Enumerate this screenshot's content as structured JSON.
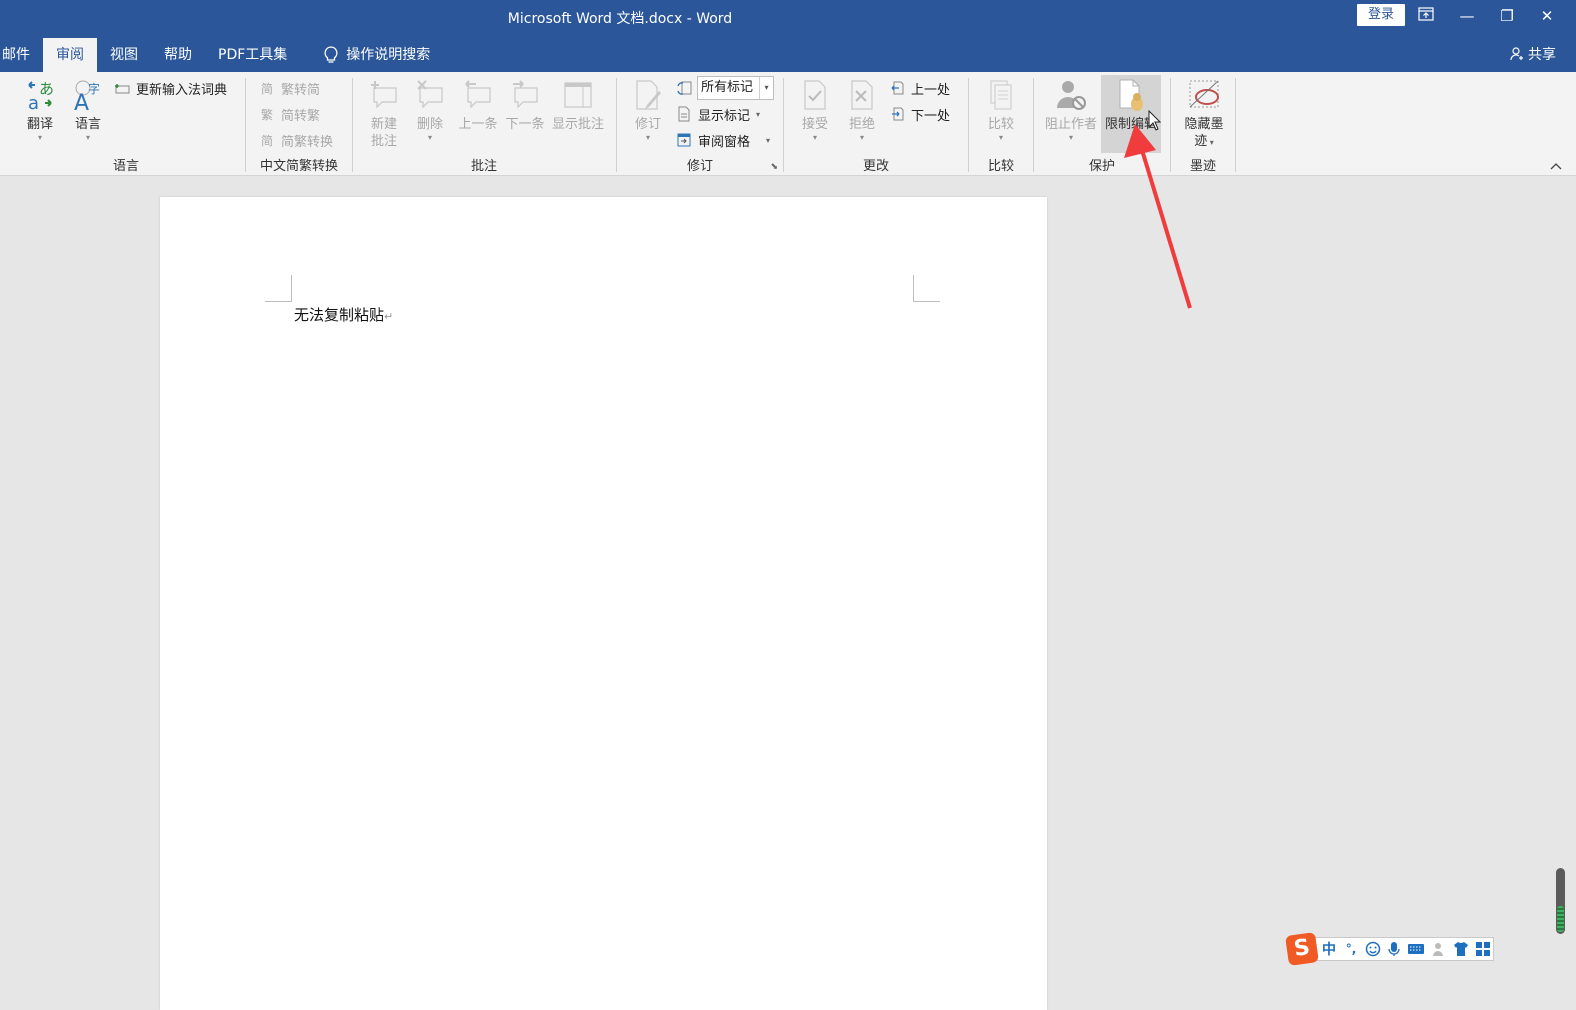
{
  "window": {
    "title": "Microsoft Word 文档.docx  -  Word",
    "login_label": "登录",
    "controls": {
      "ribbon_display": "ribbon-display-icon",
      "minimize": "—",
      "restore": "❐",
      "close": "✕"
    }
  },
  "tabs": [
    {
      "label": "邮件",
      "active": false
    },
    {
      "label": "审阅",
      "active": true
    },
    {
      "label": "视图",
      "active": false
    },
    {
      "label": "帮助",
      "active": false
    },
    {
      "label": "PDF工具集",
      "active": false
    }
  ],
  "tell_me": {
    "icon": "lightbulb-icon",
    "label": "操作说明搜索"
  },
  "share": {
    "icon": "person-add-icon",
    "label": "共享"
  },
  "ribbon": {
    "language": {
      "label": "语言",
      "translate": "翻译",
      "language": "语言",
      "update_ime_dict": "更新输入法词典"
    },
    "chinese_conversion": {
      "label": "中文简繁转换",
      "trad_to_simp": "繁转简",
      "simp_to_trad": "简转繁",
      "convert": "简繁转换"
    },
    "comments": {
      "label": "批注",
      "new_line1": "新建",
      "new_line2": "批注",
      "delete": "删除",
      "previous": "上一条",
      "next": "下一条",
      "show": "显示批注"
    },
    "tracking": {
      "label": "修订",
      "track_changes": "修订",
      "markup_select": "所有标记",
      "show_markup": "显示标记",
      "reviewing_pane": "审阅窗格"
    },
    "changes": {
      "label": "更改",
      "accept": "接受",
      "reject": "拒绝",
      "previous": "上一处",
      "next": "下一处"
    },
    "compare": {
      "label": "比较",
      "compare": "比较"
    },
    "protect": {
      "label": "保护",
      "block_authors": "阻止作者",
      "restrict_editing": "限制编辑"
    },
    "ink": {
      "label": "墨迹",
      "hide_ink_line1": "隐藏墨",
      "hide_ink_line2": "迹"
    }
  },
  "document": {
    "paragraph": "无法复制粘贴",
    "paragraph_mark": "↵"
  },
  "ime_toolbar": {
    "logo": "S",
    "mode": "中",
    "punct": "°,",
    "items": [
      "emoji-icon",
      "microphone-icon",
      "keyboard-icon",
      "user-icon",
      "skin-icon",
      "toolbox-icon"
    ]
  },
  "colors": {
    "titlebar": "#2b579a",
    "ribbon": "#f3f3f3",
    "annotation_arrow": "#f03c3c"
  }
}
